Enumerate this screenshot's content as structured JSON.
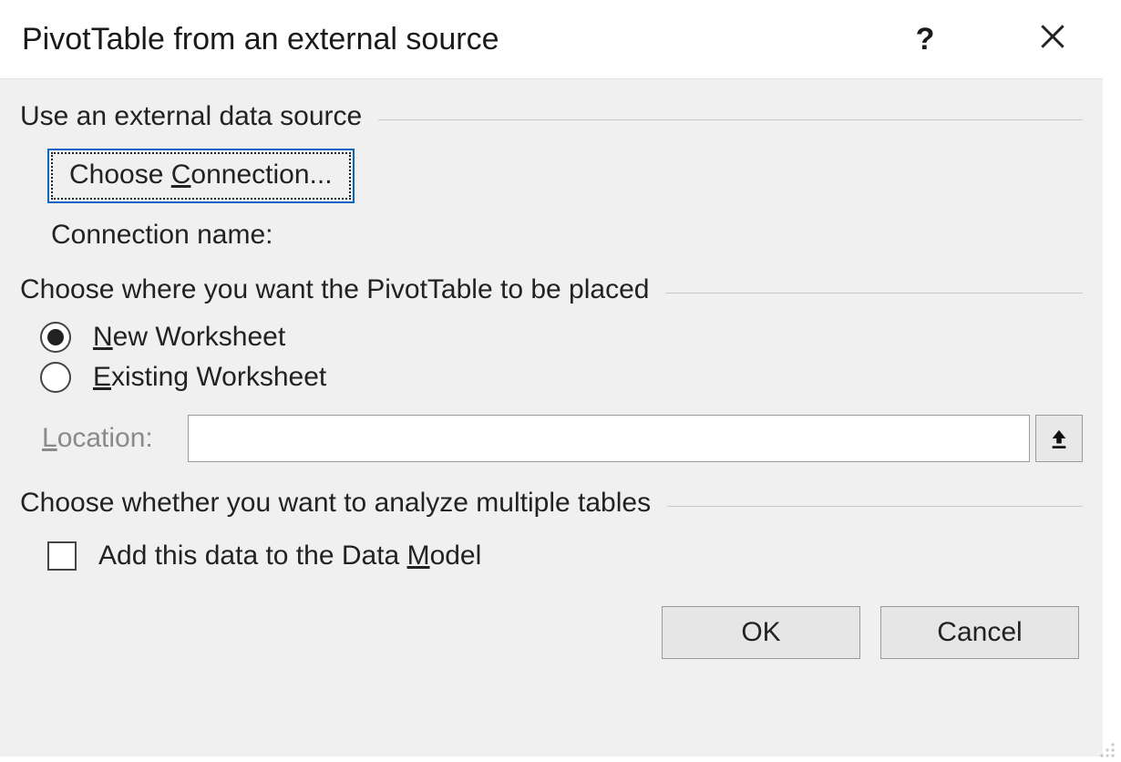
{
  "dialog": {
    "title": "PivotTable from an external source"
  },
  "section1": {
    "heading": "Use an external data source",
    "choose_connection_pre": "Choose ",
    "choose_connection_accel": "C",
    "choose_connection_post": "onnection...",
    "connection_name_label": "Connection name:"
  },
  "section2": {
    "heading": "Choose where you want the PivotTable to be placed",
    "radio_new_accel": "N",
    "radio_new_post": "ew Worksheet",
    "radio_existing_accel": "E",
    "radio_existing_post": "xisting Worksheet",
    "location_label_accel": "L",
    "location_label_post": "ocation:",
    "location_value": ""
  },
  "section3": {
    "heading": "Choose whether you want to analyze multiple tables",
    "checkbox_pre": "Add this data to the Data ",
    "checkbox_accel": "M",
    "checkbox_post": "odel"
  },
  "footer": {
    "ok": "OK",
    "cancel": "Cancel"
  }
}
